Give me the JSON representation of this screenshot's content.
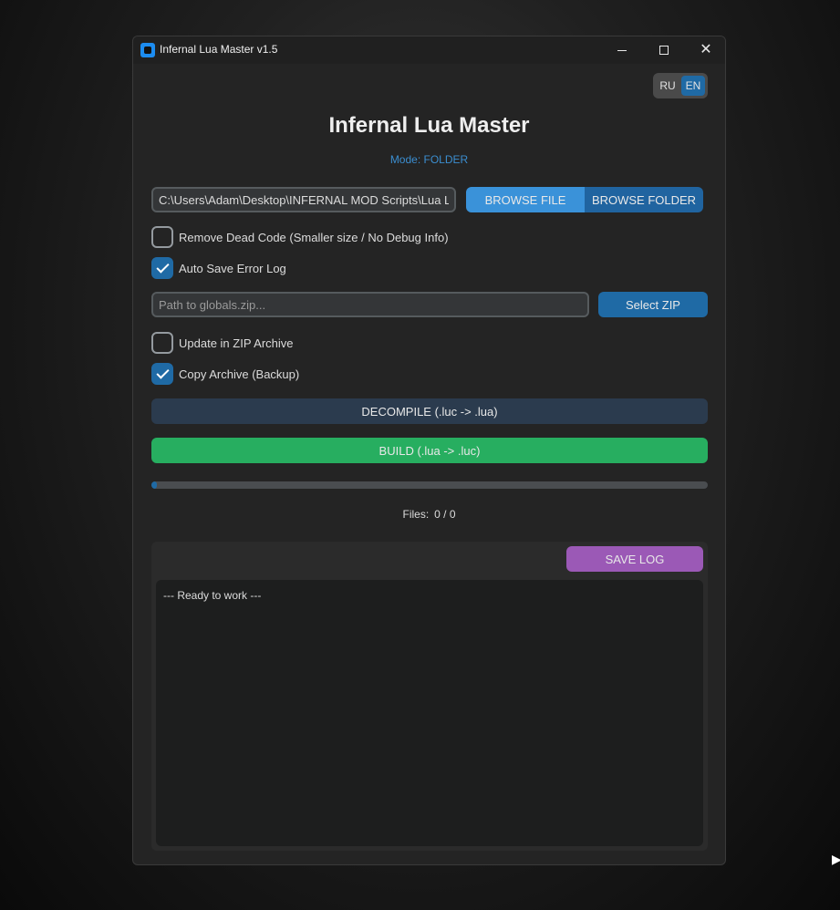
{
  "window": {
    "title": "Infernal Lua Master v1.5",
    "controls": {
      "minimize": "minimize-icon",
      "maximize": "maximize-icon",
      "close": "close-icon"
    }
  },
  "language": {
    "ru": "RU",
    "en": "EN",
    "selected": "EN"
  },
  "header": {
    "title": "Infernal Lua Master",
    "mode": "Mode: FOLDER"
  },
  "source": {
    "path_value": "C:\\Users\\Adam\\Desktop\\INFERNAL MOD Scripts\\Lua Lu",
    "browse_file": "BROWSE FILE",
    "browse_folder": "BROWSE FOLDER"
  },
  "options": {
    "remove_dead_code": {
      "label": "Remove Dead Code (Smaller size / No Debug Info)",
      "checked": false
    },
    "auto_save_error_log": {
      "label": "Auto Save Error Log",
      "checked": true
    }
  },
  "zip": {
    "placeholder": "Path to globals.zip...",
    "value": "",
    "select_button": "Select ZIP",
    "update_in_zip": {
      "label": "Update in ZIP Archive",
      "checked": false
    },
    "copy_archive": {
      "label": "Copy Archive (Backup)",
      "checked": true
    }
  },
  "actions": {
    "decompile": "DECOMPILE (.luc -> .lua)",
    "build": "BUILD (.lua -> .luc)"
  },
  "progress": {
    "fraction": 0.01,
    "files_label": "Files:",
    "files_value": "0 / 0"
  },
  "log": {
    "save_button": "SAVE LOG",
    "text": "--- Ready to work ---"
  },
  "colors": {
    "accent_blue": "#1f6aa5",
    "browse_file": "#3a92d9",
    "decompile": "#2b3b4e",
    "build": "#27ae60",
    "save_log": "#9b59b6",
    "mode_text": "#3b8ed0"
  }
}
